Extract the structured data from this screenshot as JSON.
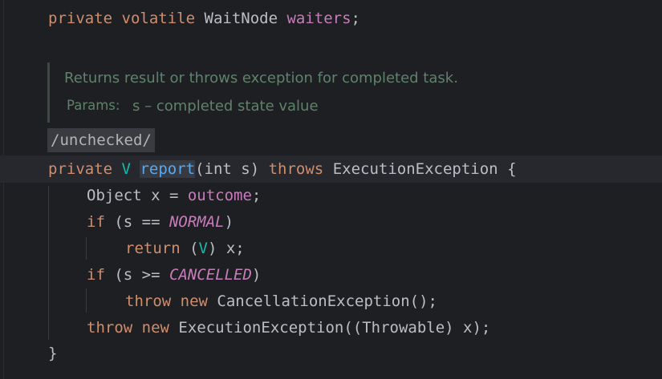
{
  "code": {
    "field_decl": {
      "kw_private": "private",
      "kw_volatile": "volatile",
      "type": "WaitNode",
      "name": "waiters",
      "semicolon": ";"
    },
    "doc": {
      "summary": "Returns result or throws exception for completed task.",
      "params_label": "Params:",
      "params_value": "s – completed state value"
    },
    "annotation": "/unchecked/",
    "method_sig": {
      "kw_private": "private",
      "type_param": "V",
      "name": "report",
      "params": "(int s)",
      "kw_throws": "throws",
      "exception": "ExecutionException",
      "brace": "{"
    },
    "line_outcome": {
      "text_before": "Object x = ",
      "field": "outcome",
      "text_after": ";"
    },
    "line_if_normal": {
      "kw_if": "if",
      "text_before": " (s == ",
      "const": "NORMAL",
      "text_after": ")"
    },
    "line_return": {
      "kw_return": "return",
      "text_before": " (",
      "type_param": "V",
      "text_after": ") x;"
    },
    "line_if_cancelled": {
      "kw_if": "if",
      "text_before": " (s >= ",
      "const": "CANCELLED",
      "text_after": ")"
    },
    "line_throw_cancel": {
      "kw_throw": "throw",
      "kw_new": "new",
      "text": " CancellationException();"
    },
    "line_throw_exec": {
      "kw_throw": "throw",
      "kw_new": "new",
      "text": " ExecutionException((Throwable) x);"
    },
    "closing_brace": "}"
  },
  "colors": {
    "background": "#1e1f22",
    "keyword": "#cf8e6d",
    "field": "#c77dbb",
    "method": "#56a8f5",
    "type_param": "#16baac",
    "doc_comment": "#5f826b",
    "plain": "#bcbec4"
  }
}
